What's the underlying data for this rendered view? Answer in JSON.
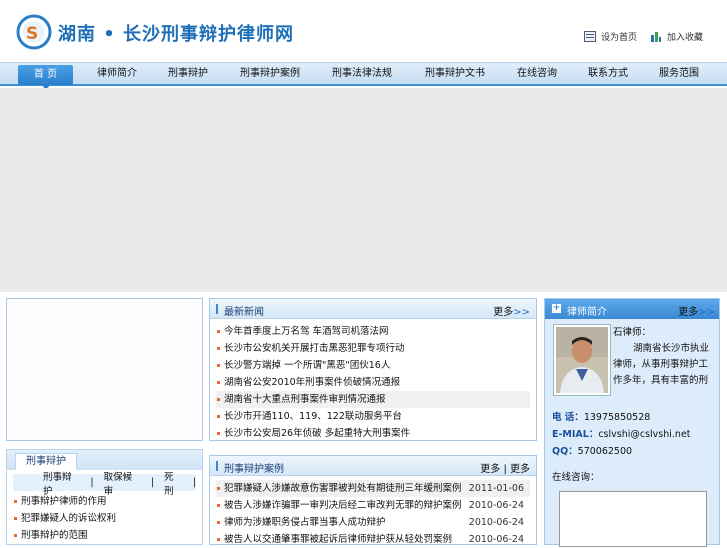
{
  "header": {
    "site_title": "湖南 • 长沙刑事辩护律师网",
    "set_home": "设为首页",
    "add_fav": "加入收藏"
  },
  "nav": {
    "items": [
      "首 页",
      "律师简介",
      "刑事辩护",
      "刑事辩护案例",
      "刑事法律法规",
      "刑事辩护文书",
      "在线咨询",
      "联系方式",
      "服务范围"
    ]
  },
  "news": {
    "title": "最新新闻",
    "more": "更多",
    "more_arrow": ">>",
    "items": [
      "今年首季度上万名驾 车酒驾司机落法网",
      "长沙市公安机关开展打击黑恶犯罪专项行动",
      "长沙警方端掉 一个所谓\"黑恶\"团伙16人",
      "湖南省公安2010年刑事案件侦破情况通报",
      "湖南省十大重点刑事案件审判情况通报",
      "长沙市开通110、119、122联动服务平台",
      "长沙市公安局26年侦破 多起重特大刑事案件"
    ]
  },
  "cases": {
    "title": "刑事辩护案例",
    "links": [
      "更多",
      "|",
      "更多"
    ],
    "items": [
      {
        "text": "犯罪嫌疑人涉嫌故意伤害罪被判处有期徒刑三年缓刑案例",
        "date": "2011-01-06"
      },
      {
        "text": "被告人涉嫌诈骗罪一审判决后经二审改判无罪的辩护案例",
        "date": "2010-06-24"
      },
      {
        "text": "律师为涉嫌职务侵占罪当事人成功辩护",
        "date": "2010-06-24"
      },
      {
        "text": "被告人以交通肇事罪被起诉后律师辩护获从轻处罚案例",
        "date": "2010-06-24"
      }
    ]
  },
  "lawyer": {
    "title": "律师简介",
    "more": "更多",
    "more_arrow": ">>",
    "name": "石律师：",
    "intro": "湖南省长沙市执业律师，从事刑事辩护工作多年，具有丰富的刑事案件办理经验 …",
    "phone_label": "电 话：",
    "phone": "13975850528",
    "email_label": "E-MIAL：",
    "email": "cslvshi@cslvshi.net",
    "qq_label": "QQ：",
    "qq": "570062500",
    "consult_label": "在线咨询："
  },
  "left_box": {
    "title": "刑事辩护",
    "tabs": [
      "刑事辩护",
      "|",
      "取保候审",
      "|",
      "死刑",
      "|"
    ],
    "items": [
      "刑事辩护律师的作用",
      "犯罪嫌疑人的诉讼权利",
      "刑事辩护的范围"
    ]
  },
  "colors": {
    "brand": "#1f6fb8",
    "nav_active": "#2a7ecb",
    "bullet": "#e46b2b",
    "panel_border": "#a9c9e8"
  },
  "icons": [
    "cs-logo-icon",
    "home-page-icon",
    "bookmark-icon",
    "plus-icon",
    "portrait-photo"
  ]
}
